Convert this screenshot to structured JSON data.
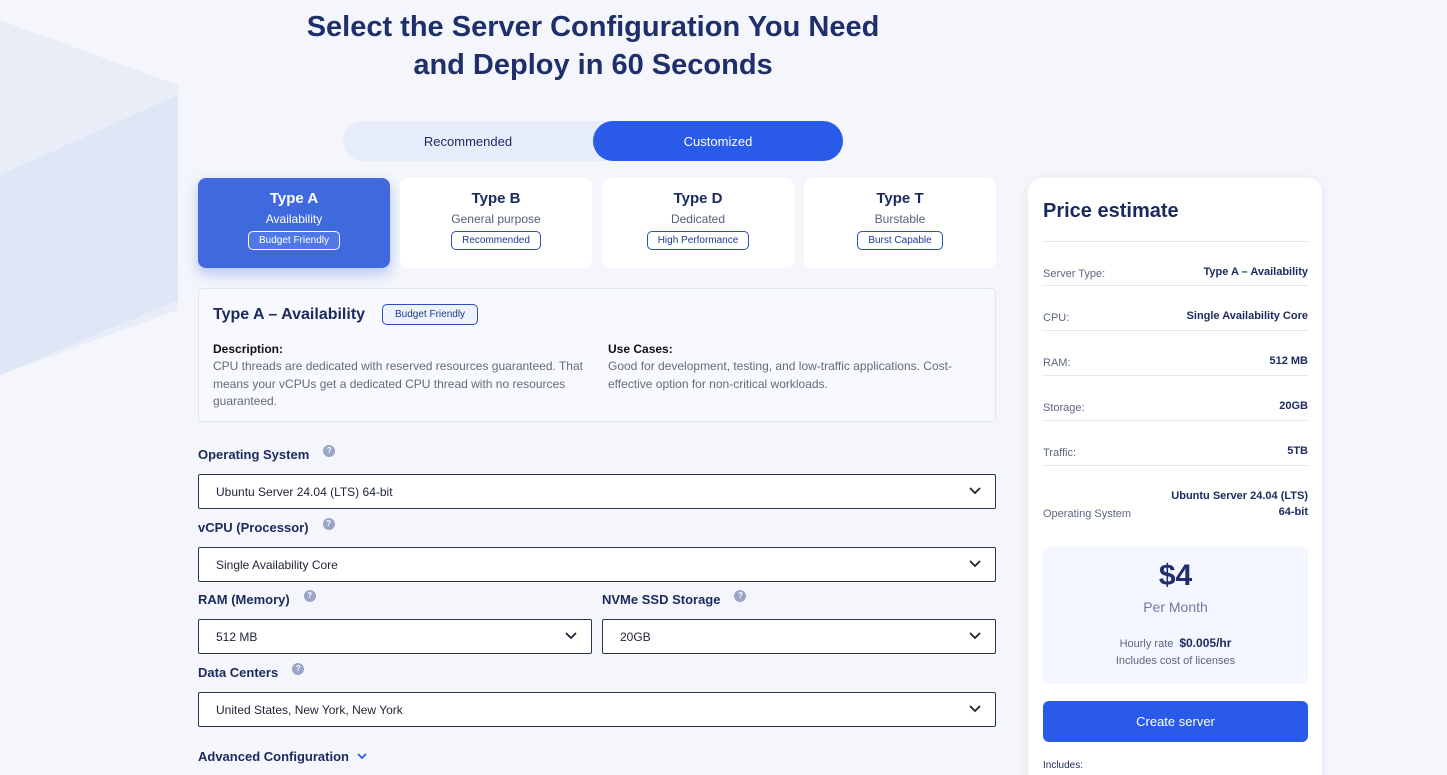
{
  "headline": {
    "line1": "Select the Server Configuration You Need",
    "line2": "and Deploy in 60 Seconds"
  },
  "mode_toggle": {
    "recommended": "Recommended",
    "customized": "Customized",
    "selected": "Customized"
  },
  "types": [
    {
      "title": "Type A",
      "subtitle": "Availability",
      "badge": "Budget Friendly",
      "selected": true
    },
    {
      "title": "Type B",
      "subtitle": "General purpose",
      "badge": "Recommended",
      "selected": false
    },
    {
      "title": "Type D",
      "subtitle": "Dedicated",
      "badge": "High Performance",
      "selected": false
    },
    {
      "title": "Type T",
      "subtitle": "Burstable",
      "badge": "Burst Capable",
      "selected": false
    }
  ],
  "details": {
    "title": "Type A – Availability",
    "badge": "Budget Friendly",
    "description_label": "Description:",
    "description_line1": "CPU threads are dedicated with reserved resources guaranteed. That",
    "description_line2": "means your vCPUs get a dedicated CPU thread with no resources",
    "description_line3": "guaranteed.",
    "use_cases_label": "Use Cases:",
    "use_cases_line1": "Good for development, testing, and low-traffic applications. Cost-",
    "use_cases_line2": "effective option for non-critical workloads."
  },
  "form": {
    "help_glyph": "?",
    "os": {
      "label": "Operating System",
      "value": "Ubuntu Server 24.04 (LTS) 64-bit"
    },
    "vcpu": {
      "label": "vCPU (Processor)",
      "value": "Single Availability Core"
    },
    "ram": {
      "label": "RAM (Memory)",
      "value": "512 MB"
    },
    "storage": {
      "label": "NVMe SSD Storage",
      "value": "20GB"
    },
    "datacenter": {
      "label": "Data Centers",
      "value": "United States, New York, New York"
    },
    "advanced": "Advanced Configuration"
  },
  "price": {
    "title": "Price estimate",
    "rows": [
      {
        "key": "Server Type:",
        "value": "Type A – Availability"
      },
      {
        "key": "CPU:",
        "value": "Single Availability Core"
      },
      {
        "key": "RAM:",
        "value": "512 MB"
      },
      {
        "key": "Storage:",
        "value": "20GB"
      },
      {
        "key": "Traffic:",
        "value": "5TB"
      }
    ],
    "os_key": "Operating System",
    "os_value_line1": "Ubuntu Server 24.04 (LTS)",
    "os_value_line2": "64-bit",
    "amount": "$4",
    "period": "Per Month",
    "hourly_label": "Hourly rate",
    "hourly_value": "$0.005/hr",
    "licenses": "Includes cost of licenses",
    "create_button": "Create server",
    "includes_label": "Includes:"
  },
  "colors": {
    "primary": "#2a5ae8",
    "selected_card": "#4069e0",
    "heading": "#1f2f6b"
  }
}
